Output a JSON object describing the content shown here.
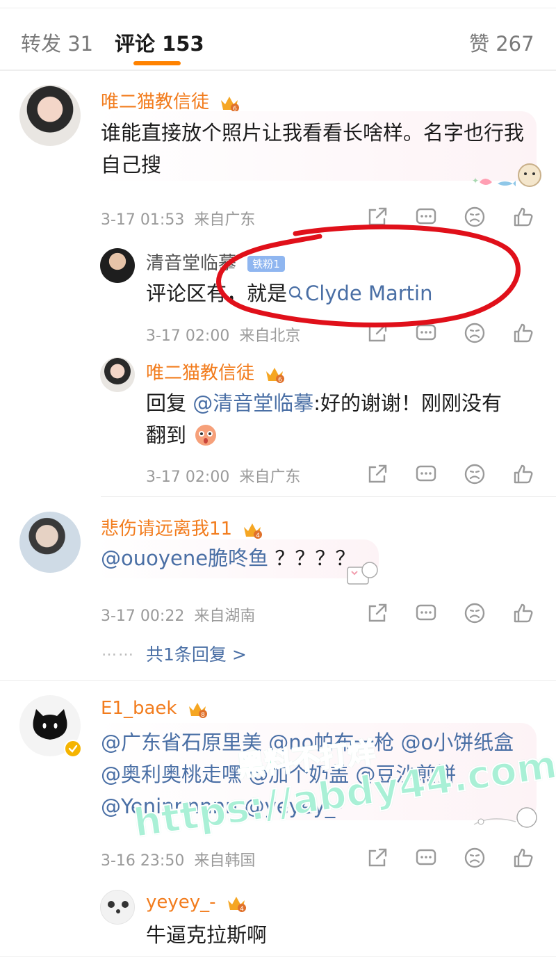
{
  "tabs": {
    "repost": "转发 31",
    "comments": "评论 153",
    "likes": "赞 267"
  },
  "comments": [
    {
      "user": "唯二猫教信徒",
      "text": "谁能直接放个照片让我看看长啥样。名字也行我自己搜",
      "time": "3-17 01:53",
      "location": "来自广东",
      "replies": [
        {
          "user": "清音堂临摹",
          "badge": "铁粉1",
          "text_prefix": "评论区有，就是",
          "search_link": "Clyde Martin",
          "time": "3-17 02:00",
          "location": "来自北京"
        },
        {
          "user": "唯二猫教信徒",
          "text_prefix": "回复",
          "mention": "@清音堂临摹",
          "text_suffix": ":好的谢谢！刚刚没有翻到",
          "time": "3-17 02:00",
          "location": "来自广东"
        }
      ]
    },
    {
      "user": "悲伤请远离我11",
      "mention": "@ouoyene脆咚鱼",
      "text": "？？？？",
      "time": "3-17 00:22",
      "location": "来自湖南",
      "more_replies": "共1条回复 >",
      "more_dots": "……"
    },
    {
      "user": "E1_baek",
      "text_line1": "@广东省石原里美 @no帕布一枪 @o小饼纸盒",
      "text_line2": "@奥利奥桃走嘿 @加个奶盖 @豆沙煎饼",
      "text_line3": "@Yeninnnnnn @yeyey_-",
      "time": "3-16 23:50",
      "location": "来自韩国",
      "replies": [
        {
          "user": "yeyey_-",
          "text": "牛逼克拉斯啊"
        }
      ]
    }
  ],
  "watermark": {
    "line1": "黑料不打烊",
    "line2": "https://abdy44.com"
  },
  "colors": {
    "accent": "#ff8200",
    "username": "#f27c1d",
    "link": "#4a6fa5",
    "annotation_red": "#e0101a"
  }
}
